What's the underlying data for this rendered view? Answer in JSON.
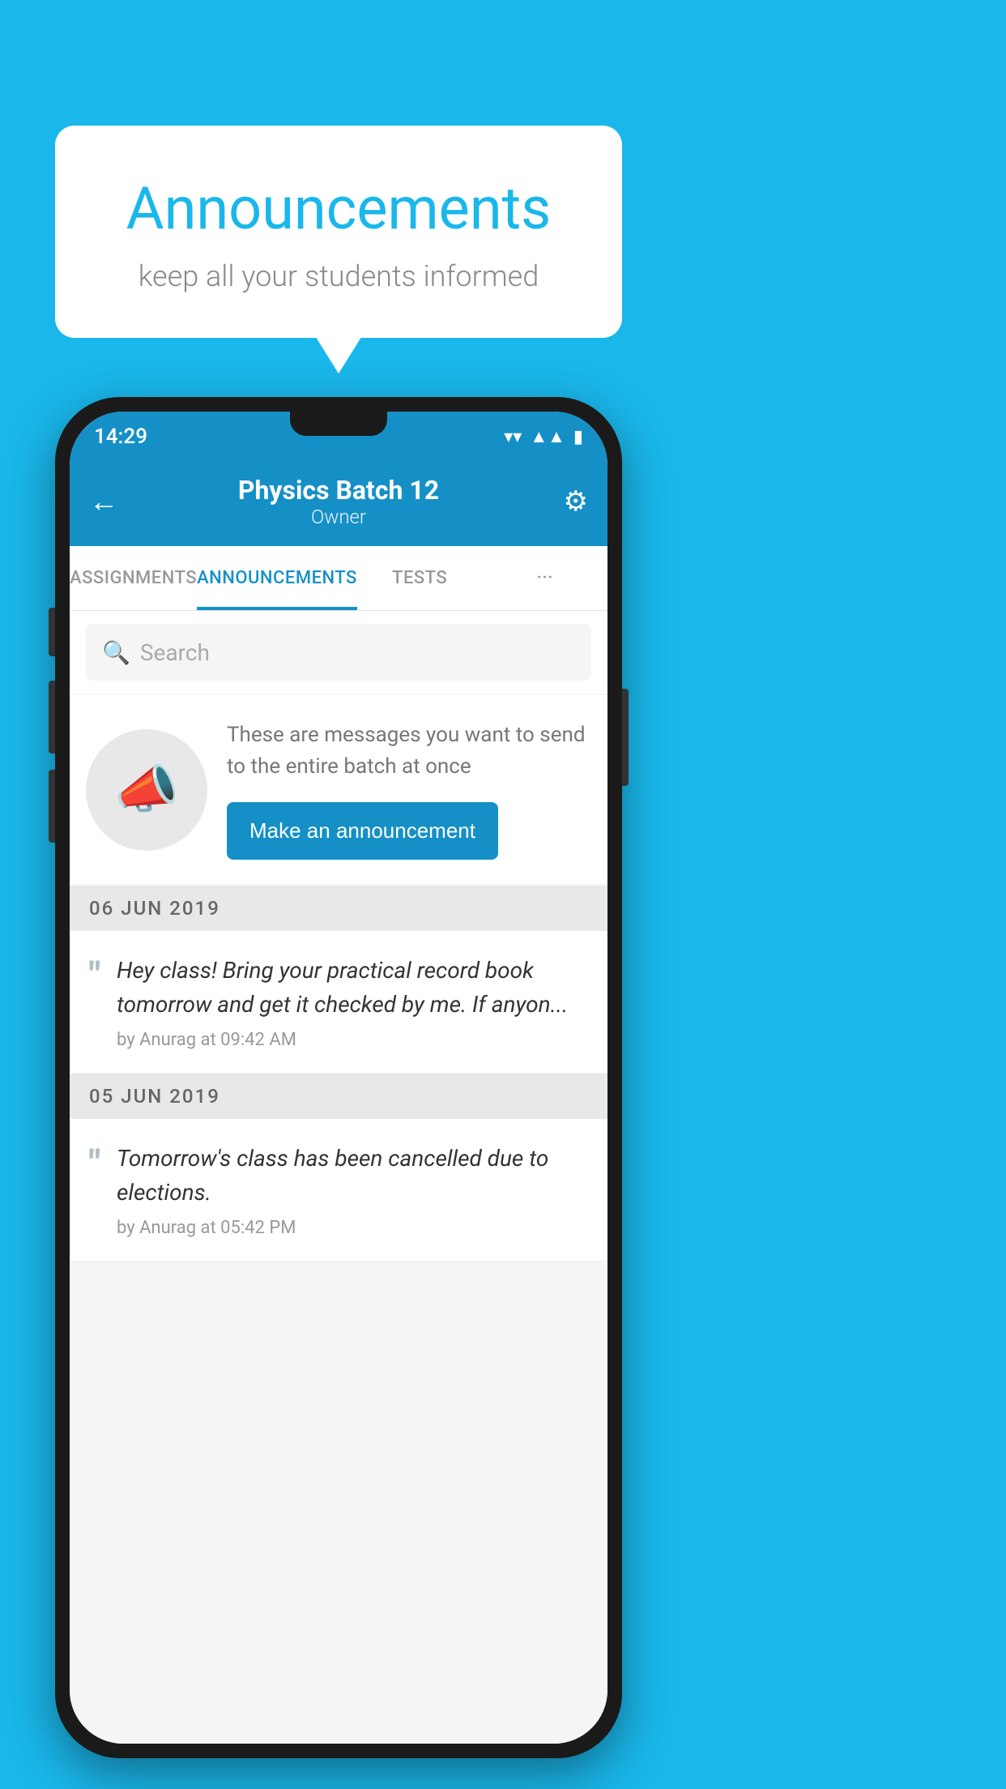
{
  "bubble": {
    "title": "Announcements",
    "subtitle": "keep all your students informed"
  },
  "status_bar": {
    "time": "14:29",
    "wifi_icon": "▾",
    "signal_icon": "▴▴",
    "battery_icon": "▮"
  },
  "header": {
    "title": "Physics Batch 12",
    "subtitle": "Owner",
    "back_label": "←",
    "gear_label": "⚙"
  },
  "tabs": [
    {
      "label": "ASSIGNMENTS",
      "active": false
    },
    {
      "label": "ANNOUNCEMENTS",
      "active": true
    },
    {
      "label": "TESTS",
      "active": false
    },
    {
      "label": "···",
      "active": false
    }
  ],
  "search": {
    "placeholder": "Search"
  },
  "promo": {
    "description": "These are messages you want to send to the entire batch at once",
    "button_label": "Make an announcement"
  },
  "announcements": [
    {
      "date": "06  JUN  2019",
      "text": "Hey class! Bring your practical record book tomorrow and get it checked by me. If anyon...",
      "meta": "by Anurag at 09:42 AM"
    },
    {
      "date": "05  JUN  2019",
      "text": "Tomorrow's class has been cancelled due to elections.",
      "meta": "by Anurag at 05:42 PM"
    }
  ],
  "colors": {
    "primary": "#1590c7",
    "background": "#1ab7ea",
    "white": "#ffffff"
  }
}
